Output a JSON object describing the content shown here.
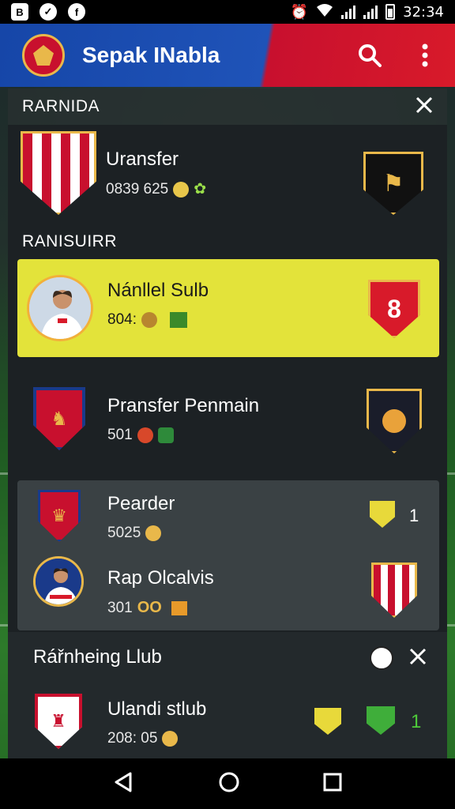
{
  "status_bar": {
    "left_icons": [
      "B",
      "check",
      "f"
    ],
    "time": "32:34"
  },
  "appbar": {
    "title": "Sepak INabla",
    "colors": {
      "blue": "#1f53b8",
      "red": "#d81a2a",
      "gold": "#e9b84a"
    }
  },
  "top_section": {
    "header": "RARNIDA",
    "row": {
      "title": "Uransfer",
      "sub": "0839 625"
    }
  },
  "section2": {
    "label": "RANISUIRR",
    "highlight": {
      "title": "Nánllel Sulb",
      "sub": "804:"
    },
    "row": {
      "title": "Pransfer Penmain",
      "sub": "501"
    }
  },
  "grey_section": {
    "rows": [
      {
        "title": "Pearder",
        "sub": "5025",
        "count": "1"
      },
      {
        "title": "Rap Olcalvis",
        "sub": "301"
      }
    ]
  },
  "bottom_card": {
    "header": "Rářnheing Llub",
    "row": {
      "title": "Ulandi stlub",
      "sub": "208: 05",
      "count": "1"
    }
  },
  "colors": {
    "highlight": "#e3e33a",
    "panel": "#1c2124"
  }
}
